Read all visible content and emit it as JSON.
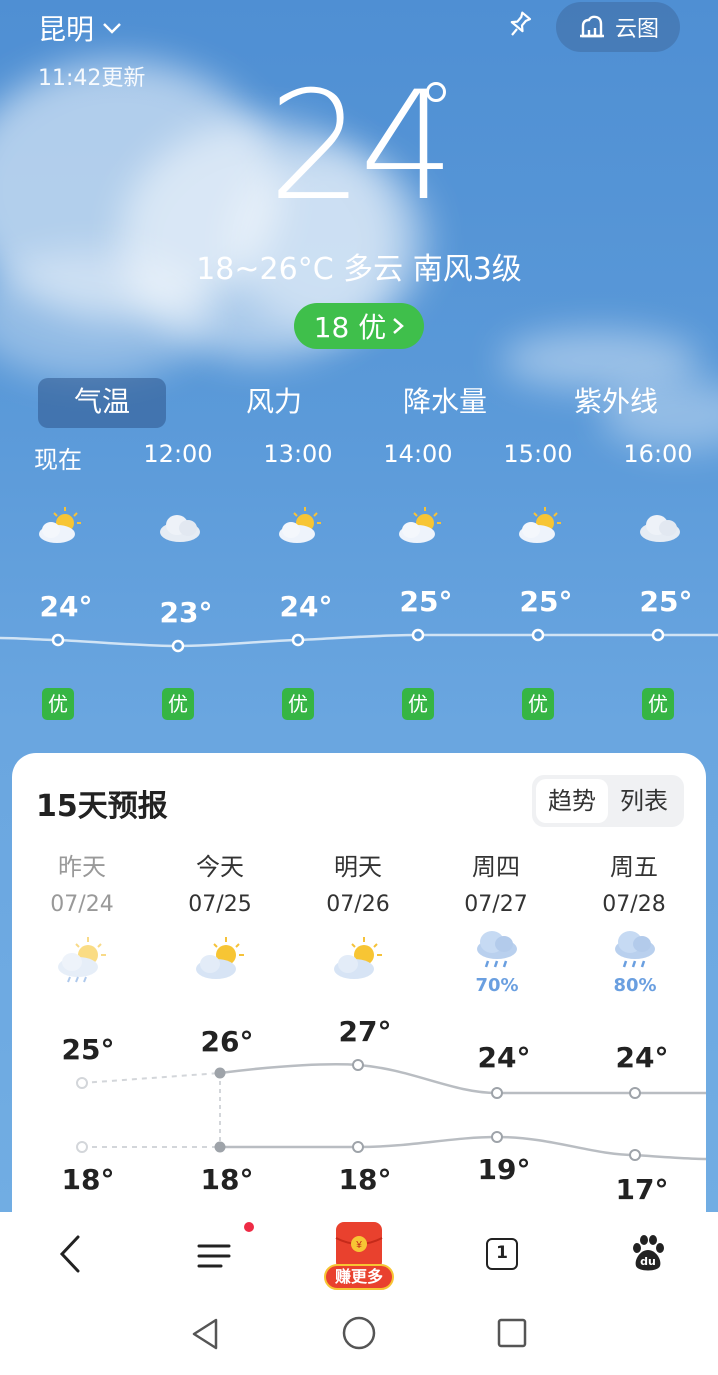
{
  "header": {
    "city": "昆明",
    "updated": "11:42更新",
    "cloud_map_label": "云图",
    "current_temp": "24",
    "summary": "18~26°C 多云 南风3级",
    "aqi_value": "18 优"
  },
  "tabs": [
    "气温",
    "风力",
    "降水量",
    "紫外线"
  ],
  "hourly": [
    {
      "time": "现在",
      "icon": "sunny-cloudy-icon",
      "temp": "24°",
      "aqi": "优"
    },
    {
      "time": "12:00",
      "icon": "cloudy-icon",
      "temp": "23°",
      "aqi": "优"
    },
    {
      "time": "13:00",
      "icon": "sunny-cloudy-icon",
      "temp": "24°",
      "aqi": "优"
    },
    {
      "time": "14:00",
      "icon": "sunny-cloudy-icon",
      "temp": "25°",
      "aqi": "优"
    },
    {
      "time": "15:00",
      "icon": "sunny-cloudy-icon",
      "temp": "25°",
      "aqi": "优"
    },
    {
      "time": "16:00",
      "icon": "cloudy-icon",
      "temp": "25°",
      "aqi": "优"
    }
  ],
  "forecast": {
    "title": "15天预报",
    "toggle": [
      "趋势",
      "列表"
    ],
    "days": [
      {
        "name": "昨天",
        "date": "07/24",
        "icon": "sunny-cloudy-rain-icon",
        "prob": "",
        "high": "25°",
        "low": "18°"
      },
      {
        "name": "今天",
        "date": "07/25",
        "icon": "sunny-cloudy-icon",
        "prob": "",
        "high": "26°",
        "low": "18°"
      },
      {
        "name": "明天",
        "date": "07/26",
        "icon": "sunny-cloudy-icon",
        "prob": "",
        "high": "27°",
        "low": "18°"
      },
      {
        "name": "周四",
        "date": "07/27",
        "icon": "rain-icon",
        "prob": "70%",
        "high": "24°",
        "low": "19°"
      },
      {
        "name": "周五",
        "date": "07/28",
        "icon": "rain-icon",
        "prob": "80%",
        "high": "24°",
        "low": "17°"
      }
    ]
  },
  "bottom_nav": {
    "redpacket_label": "赚更多",
    "tab_count": "1",
    "baidu_label": "du"
  },
  "colors": {
    "sky": "#5b9ad9",
    "aqi_green": "#3fbf4b",
    "rain_prob": "#6a9fe0"
  }
}
